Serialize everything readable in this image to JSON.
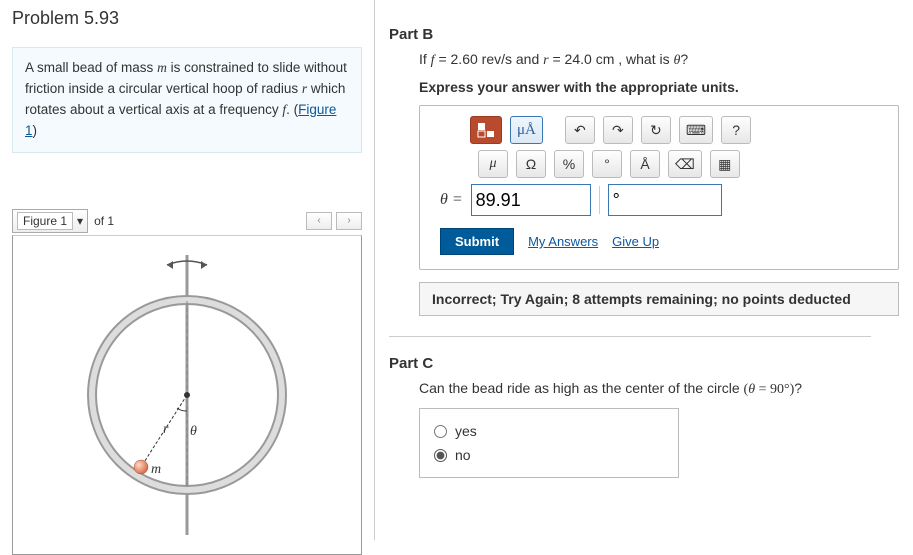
{
  "title": "Problem 5.93",
  "statement": {
    "s0": "A small bead of mass ",
    "m": "m",
    "s1": " is constrained to slide without friction inside a circular vertical hoop of radius ",
    "r": "r",
    "s2": " which rotates about a vertical axis at a frequency ",
    "f": "f",
    "s3": ". (",
    "link": "Figure 1",
    "s4": ")"
  },
  "figure": {
    "label": "Figure 1",
    "of_text": "of 1",
    "nav_prev": "‹",
    "nav_next": "›",
    "diagram": {
      "r_label": "r",
      "theta_label": "θ",
      "m_label": "m"
    }
  },
  "partB": {
    "heading": "Part B",
    "q0": "If ",
    "fvar": "f",
    "q1": " = 2.60 ",
    "frevs": "rev/s",
    "q2": " and ",
    "rvar": "r",
    "q3": " = 24.0 ",
    "cm": "cm",
    "q4": " , what is ",
    "th": "θ",
    "qmark": "?",
    "units_note": "Express your answer with the appropriate units.",
    "toolbar_top": {
      "units_btn": "μÅ",
      "undo": "↶",
      "redo": "↷",
      "reset": "↻",
      "keyboard": "⌨",
      "help": "?"
    },
    "toolbar_bot": {
      "mu": "μ",
      "omega": "Ω",
      "percent": "%",
      "deg": "°",
      "angstrom": "Å",
      "backspace": "⌫",
      "calc": "▦"
    },
    "theta_eq": "θ =",
    "value": "89.91",
    "unit": "°",
    "submit": "Submit",
    "my_answers": "My Answers",
    "give_up": "Give Up",
    "feedback": "Incorrect; Try Again; 8 attempts remaining; no points deducted"
  },
  "partC": {
    "heading": "Part C",
    "q0": "Can the bead ride as high as the center of the circle ",
    "paren": "(θ = 90°)",
    "qmark": "?",
    "options": {
      "yes": "yes",
      "no": "no"
    },
    "selected": "no"
  }
}
